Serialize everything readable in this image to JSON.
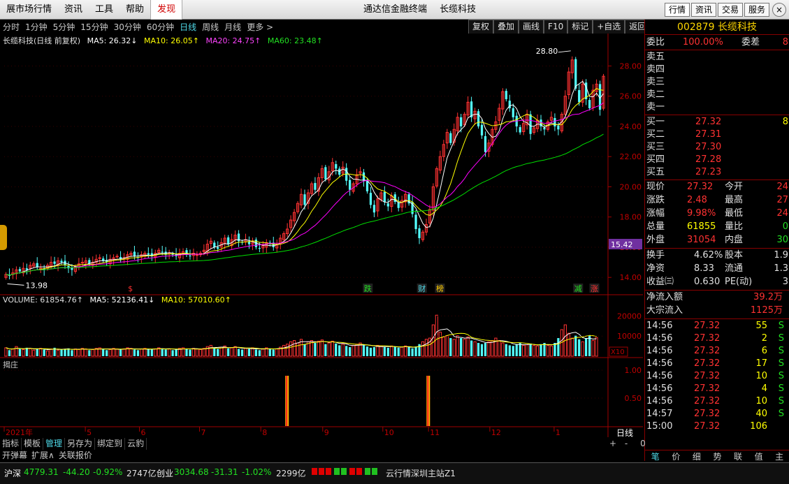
{
  "titlebar": {
    "menu": [
      "展市场行情",
      "资讯",
      "工具",
      "帮助",
      "发现"
    ],
    "active_menu": "发现",
    "app_title": "通达信金融终端",
    "stock_title": "长缆科技",
    "right_buttons": [
      "行情",
      "资讯",
      "交易",
      "服务"
    ],
    "close_glyph": "×"
  },
  "periods": [
    "分时",
    "1分钟",
    "5分钟",
    "15分钟",
    "30分钟",
    "60分钟",
    "日线",
    "周线",
    "月线",
    "更多 >"
  ],
  "active_period": "日线",
  "tool_buttons": [
    "复权",
    "叠加",
    "画线",
    "F10",
    "标记",
    "+自选",
    "返回"
  ],
  "ma_legend": {
    "name": "长缆科技(日线 前复权)",
    "ma5": "MA5: 26.32↓",
    "ma10": "MA10: 26.05↑",
    "ma20": "MA20: 24.75↑",
    "ma60": "MA60: 23.48↑"
  },
  "vol_legend": {
    "volume": "VOLUME: 61854.76↑",
    "ma5": "MA5: 52136.41↓",
    "ma10": "MA10: 57010.60↑"
  },
  "indicator_label": "揭庄",
  "price_axis": [
    "28.00",
    "26.00",
    "24.00",
    "22.00",
    "20.00",
    "18.00",
    "16.00",
    "14.00"
  ],
  "current_price_tag": "15.42",
  "high_marker": "28.80",
  "low_marker": "13.98",
  "vol_axis": [
    "20000",
    "10000"
  ],
  "vol_unit": "X10",
  "ind_axis": [
    "1.00",
    "0.50"
  ],
  "months": [
    "2021年",
    "5",
    "6",
    "7",
    "8",
    "9",
    "10",
    "11",
    "12",
    "1"
  ],
  "period_tag": "日线",
  "event_markers": [
    "$",
    "跌",
    "财",
    "榜",
    "减",
    "涨"
  ],
  "zoom_controls": [
    "+",
    "-",
    "0"
  ],
  "chart_data": {
    "type": "candlestick",
    "ylim": [
      13.5,
      29.5
    ],
    "colors": {
      "up": "#ff3232",
      "down": "#54ffff",
      "ma5": "#ffffff",
      "ma10": "#ffff00",
      "ma20": "#ff00ff",
      "ma60": "#00e000"
    },
    "close": [
      14.2,
      14.1,
      14.3,
      14.5,
      14.4,
      14.6,
      14.5,
      14.8,
      14.9,
      14.7,
      14.6,
      14.5,
      14.8,
      15.0,
      14.9,
      15.1,
      15.0,
      14.8,
      14.6,
      14.5,
      14.7,
      14.9,
      15.0,
      15.1,
      14.9,
      15.0,
      15.2,
      15.3,
      15.1,
      15.0,
      15.2,
      15.3,
      15.4,
      15.2,
      15.3,
      15.5,
      15.6,
      15.4,
      15.3,
      15.5,
      15.6,
      15.5,
      15.4,
      15.6,
      15.8,
      15.7,
      15.5,
      15.6,
      15.5,
      15.4,
      15.6,
      15.7,
      15.5,
      15.4,
      15.6,
      15.5,
      15.6,
      15.8,
      16.2,
      16.4,
      16.0,
      15.9,
      16.3,
      16.6,
      16.2,
      16.5,
      16.8,
      16.4,
      16.3,
      16.5,
      16.2,
      16.4,
      16.0,
      15.9,
      16.1,
      16.3,
      16.2,
      16.0,
      16.2,
      16.6,
      16.9,
      17.2,
      17.8,
      18.3,
      18.9,
      19.5,
      18.8,
      19.6,
      20.2,
      19.8,
      20.6,
      21.2,
      20.5,
      21.0,
      21.6,
      21.2,
      20.8,
      21.3,
      20.4,
      19.8,
      20.2,
      20.8,
      21.0,
      20.4,
      19.7,
      18.8,
      18.3,
      19.2,
      19.6,
      19.0,
      18.7,
      19.4,
      19.0,
      18.6,
      19.1,
      19.5,
      18.9,
      18.2,
      17.2,
      16.6,
      17.0,
      17.5,
      18.5,
      20.0,
      21.2,
      22.0,
      22.8,
      23.6,
      22.9,
      23.8,
      24.6,
      24.0,
      24.8,
      25.6,
      24.6,
      25.0,
      24.0,
      23.4,
      22.3,
      22.9,
      23.8,
      24.3,
      25.2,
      26.3,
      25.8,
      25.2,
      24.6,
      24.0,
      23.6,
      24.2,
      24.8,
      23.5,
      23.9,
      24.4,
      24.0,
      23.8,
      24.3,
      24.6,
      24.0,
      23.8,
      24.8,
      26.0,
      27.6,
      28.4,
      26.5,
      25.6,
      26.8,
      25.8,
      25.2,
      26.4,
      26.8,
      25.1,
      27.32
    ]
  },
  "vol_data": [
    14,
    10,
    12,
    16,
    12,
    11,
    14,
    13,
    10,
    12,
    13,
    11,
    9,
    12,
    14,
    10,
    11,
    12,
    13,
    10,
    12,
    11,
    13,
    12,
    10,
    11,
    13,
    14,
    12,
    10,
    11,
    13,
    12,
    11,
    12,
    14,
    13,
    11,
    10,
    12,
    13,
    12,
    11,
    12,
    14,
    13,
    11,
    12,
    10,
    11,
    13,
    14,
    12,
    11,
    13,
    12,
    11,
    13,
    16,
    18,
    14,
    12,
    15,
    17,
    13,
    14,
    16,
    12,
    11,
    13,
    12,
    14,
    11,
    10,
    12,
    14,
    13,
    11,
    12,
    15,
    18,
    20,
    24,
    26,
    22,
    28,
    20,
    24,
    26,
    22,
    25,
    27,
    20,
    22,
    25,
    21,
    18,
    20,
    17,
    15,
    18,
    20,
    22,
    18,
    16,
    14,
    15,
    18,
    17,
    15,
    14,
    17,
    16,
    14,
    15,
    17,
    15,
    13,
    16,
    20,
    24,
    28,
    30,
    52,
    68,
    40,
    32,
    34,
    30,
    28,
    34,
    30,
    28,
    32,
    26,
    24,
    22,
    20,
    22,
    24,
    26,
    30,
    26,
    22,
    20,
    18,
    17,
    20,
    22,
    18,
    19,
    21,
    18,
    17,
    20,
    22,
    18,
    17,
    22,
    30,
    44,
    52,
    38,
    30,
    34,
    28,
    24,
    30,
    34,
    26,
    31
  ],
  "right_panel": {
    "code_name": "002879 长缆科技",
    "webi": {
      "label": "委比",
      "value": "100.00%",
      "label2": "委差",
      "value2": "8"
    },
    "sells": [
      "卖五",
      "卖四",
      "卖三",
      "卖二",
      "卖一"
    ],
    "buys": [
      {
        "label": "买一",
        "price": "27.32",
        "vol": "8"
      },
      {
        "label": "买二",
        "price": "27.31",
        "vol": ""
      },
      {
        "label": "买三",
        "price": "27.30",
        "vol": ""
      },
      {
        "label": "买四",
        "price": "27.28",
        "vol": ""
      },
      {
        "label": "买五",
        "price": "27.23",
        "vol": ""
      }
    ],
    "quote": [
      {
        "l1": "现价",
        "v1": "27.32",
        "l2": "今开",
        "v2": "24"
      },
      {
        "l1": "涨跌",
        "v1": "2.48",
        "l2": "最高",
        "v2": "27"
      },
      {
        "l1": "涨幅",
        "v1": "9.98%",
        "l2": "最低",
        "v2": "24"
      },
      {
        "l1": "总量",
        "v1": "61855",
        "l2": "量比",
        "v2": "0"
      },
      {
        "l1": "外盘",
        "v1": "31054",
        "l2": "内盘",
        "v2": "30"
      }
    ],
    "stats": [
      {
        "l1": "换手",
        "v1": "4.62%",
        "l2": "股本",
        "v2": "1.9"
      },
      {
        "l1": "净资",
        "v1": "8.33",
        "l2": "流通",
        "v2": "1.3"
      },
      {
        "l1": "收益㈢",
        "v1": "0.630",
        "l2": "PE(动)",
        "v2": "3"
      }
    ],
    "flows": [
      {
        "label": "净流入额",
        "value": "39.2万"
      },
      {
        "label": "大宗流入",
        "value": "1125万"
      }
    ],
    "ticks": [
      {
        "time": "14:56",
        "price": "27.32",
        "vol": "55",
        "bs": "S"
      },
      {
        "time": "14:56",
        "price": "27.32",
        "vol": "2",
        "bs": "S"
      },
      {
        "time": "14:56",
        "price": "27.32",
        "vol": "6",
        "bs": "S"
      },
      {
        "time": "14:56",
        "price": "27.32",
        "vol": "17",
        "bs": "S"
      },
      {
        "time": "14:56",
        "price": "27.32",
        "vol": "10",
        "bs": "S"
      },
      {
        "time": "14:56",
        "price": "27.32",
        "vol": "4",
        "bs": "S"
      },
      {
        "time": "14:56",
        "price": "27.32",
        "vol": "10",
        "bs": "S"
      },
      {
        "time": "14:57",
        "price": "27.32",
        "vol": "40",
        "bs": "S"
      },
      {
        "time": "15:00",
        "price": "27.32",
        "vol": "106",
        "bs": ""
      }
    ],
    "tabs": [
      "笔",
      "价",
      "细",
      "势",
      "联",
      "值",
      "主"
    ]
  },
  "bottom_tools": [
    "指标",
    "模板",
    "管理",
    "另存为",
    "绑定到",
    "云豹"
  ],
  "bottom_tools2": [
    "开弹幕",
    "扩展∧",
    "关联报价"
  ],
  "status": {
    "sh_label": "沪深",
    "sh_value": "4779.31",
    "sh_change": "-44.20",
    "sh_pct": "-0.92%",
    "sh_amount": "2747亿",
    "cy_label": "创业",
    "cy_value": "3034.68",
    "cy_change": "-31.31",
    "cy_pct": "-1.02%",
    "cy_amount": "2299亿",
    "server": "云行情深圳主站Z1"
  }
}
